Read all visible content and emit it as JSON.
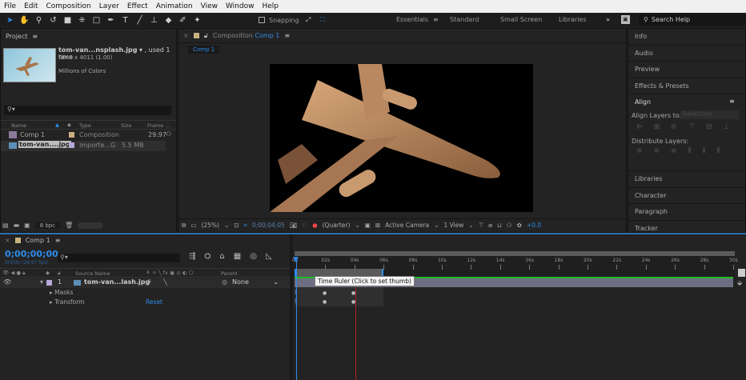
{
  "menu": [
    "File",
    "Edit",
    "Composition",
    "Layer",
    "Effect",
    "Animation",
    "View",
    "Window",
    "Help"
  ],
  "toolbar": {
    "snapping": "Snapping"
  },
  "workspaces": {
    "items": [
      "Essentials",
      "Standard",
      "Small Screen",
      "Libraries"
    ],
    "active": "Essentials",
    "more": "»",
    "search_placeholder": "Search Help"
  },
  "project": {
    "title": "Project",
    "file_name": "tom-van...nsplash.jpg",
    "used": ", used 1 time",
    "dimensions": "6048 x 4011 (1.00)",
    "colors": "Millions of Colors",
    "columns": [
      "Name",
      "Type",
      "Size",
      "Frame ..."
    ],
    "rows": [
      {
        "name": "Comp 1",
        "type": "Composition",
        "size": "",
        "frame": "29.97",
        "label_color": "#c9b27f"
      },
      {
        "name": "tom-van....jpg",
        "type": "Importe...G",
        "size": "5.5 MB",
        "frame": "",
        "label_color": "#b7a8d8"
      }
    ],
    "bpc": "8 bpc"
  },
  "composition": {
    "panel_label": "Composition",
    "comp_name": "Comp 1",
    "tab": "Comp 1",
    "zoom": "(25%)",
    "timecode": "0;00;04;05",
    "resolution": "(Quarter)",
    "camera": "Active Camera",
    "views": "1 View",
    "exposure": "+0.0"
  },
  "right_panels": {
    "items": [
      "Info",
      "Audio",
      "Preview",
      "Effects & Presets"
    ],
    "align": {
      "title": "Align",
      "align_to_label": "Align Layers to:",
      "align_to_value": "Selection",
      "distribute_label": "Distribute Layers:"
    },
    "items_after": [
      "Libraries",
      "Character",
      "Paragraph",
      "Tracker"
    ]
  },
  "timeline": {
    "tab": "Comp 1",
    "timecode": "0;00;00;00",
    "frames": "00000 (29.97 fps)",
    "columns": {
      "num": "#",
      "source": "Source Name",
      "parent": "Parent"
    },
    "layer": {
      "num": "1",
      "name": "tom-van...lash.jpg",
      "parent": "None"
    },
    "props": [
      {
        "name": "Masks"
      },
      {
        "name": "Transform",
        "action": "Reset"
      }
    ],
    "ruler": [
      "0s",
      "02s",
      "04s",
      "06s",
      "08s",
      "10s",
      "12s",
      "14s",
      "16s",
      "18s",
      "20s",
      "22s",
      "24s",
      "26s",
      "28s",
      "30s"
    ],
    "tooltip": "Time Ruler (Click to set thumb)"
  }
}
